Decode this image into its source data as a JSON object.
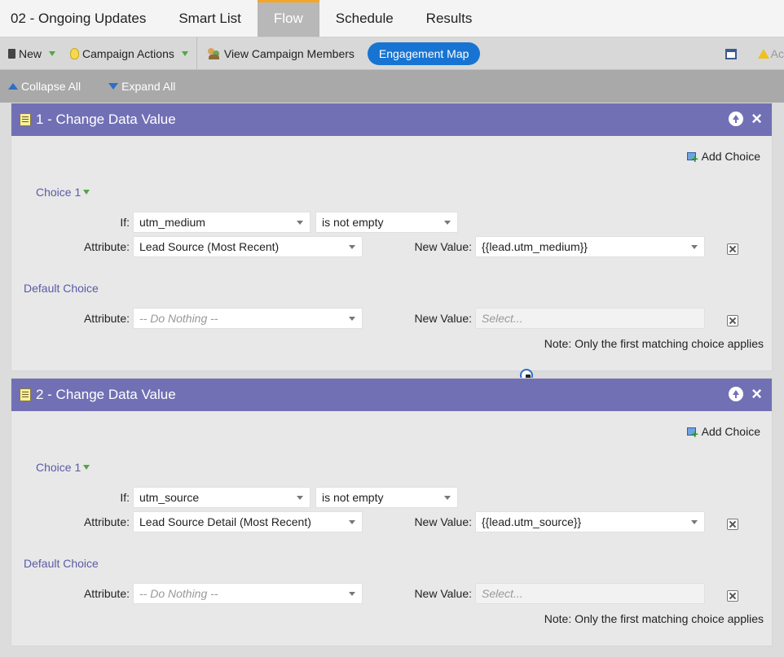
{
  "tabs": [
    {
      "label": "02 - Ongoing Updates"
    },
    {
      "label": "Smart List"
    },
    {
      "label": "Flow"
    },
    {
      "label": "Schedule"
    },
    {
      "label": "Results"
    }
  ],
  "toolbar": {
    "new_label": "New",
    "campaign_actions_label": "Campaign Actions",
    "view_members_label": "View Campaign Members",
    "engagement_map_label": "Engagement Map",
    "right_clipped_label": "Ac"
  },
  "collapse_bar": {
    "collapse_all": "Collapse All",
    "expand_all": "Expand All"
  },
  "steps": [
    {
      "title": "1 - Change Data Value",
      "add_choice": "Add Choice",
      "choice_label": "Choice 1",
      "if_label": "If:",
      "if_field": "utm_medium",
      "if_operator": "is not empty",
      "attribute_label": "Attribute:",
      "attribute_value": "Lead Source (Most Recent)",
      "new_value_label": "New Value:",
      "new_value": "{{lead.utm_medium}}",
      "default_choice_label": "Default Choice",
      "default_attribute": "-- Do Nothing --",
      "default_new_value_placeholder": "Select...",
      "note": "Note: Only the first matching choice applies"
    },
    {
      "title": "2 - Change Data Value",
      "add_choice": "Add Choice",
      "choice_label": "Choice 1",
      "if_label": "If:",
      "if_field": "utm_source",
      "if_operator": "is not empty",
      "attribute_label": "Attribute:",
      "attribute_value": "Lead Source Detail (Most Recent)",
      "new_value_label": "New Value:",
      "new_value": "{{lead.utm_source}}",
      "default_choice_label": "Default Choice",
      "default_attribute": "-- Do Nothing --",
      "default_new_value_placeholder": "Select...",
      "note": "Note: Only the first matching choice applies"
    }
  ],
  "colors": {
    "accent_tab": "#f5a623",
    "step_header": "#7170b5",
    "engagement_button": "#1874d2",
    "link_label": "#5a5aa8"
  }
}
